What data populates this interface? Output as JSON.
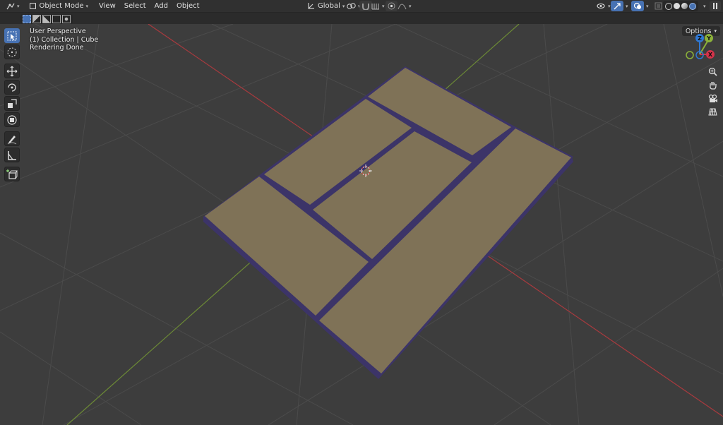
{
  "header": {
    "editor_type_icon": "editor-type-icon",
    "mode_label": "Object Mode",
    "menus": [
      "View",
      "Select",
      "Add",
      "Object"
    ],
    "orientation_label": "Global",
    "options_label": "Options"
  },
  "overlay": {
    "view_name": "User Perspective",
    "collection_line": "(1) Collection | Cube",
    "status_line": "Rendering Done"
  },
  "gizmo": {
    "axes": [
      "Z",
      "Y",
      "X"
    ],
    "colors": {
      "x": "#d4334a",
      "y": "#8cb33a",
      "z": "#2f78d4"
    }
  },
  "tools": [
    "select-box",
    "cursor",
    "move",
    "rotate",
    "scale",
    "transform",
    "annotate",
    "measure",
    "add-cube"
  ],
  "colors": {
    "viewport_bg": "#3d3d3d",
    "grid": "#4b4b4b",
    "axis_x": "#a83a3e",
    "axis_y": "#6c8a36",
    "mesh_face": "#7f7257",
    "mesh_edge": "#3c3468",
    "active_tool": "#4772b3"
  }
}
